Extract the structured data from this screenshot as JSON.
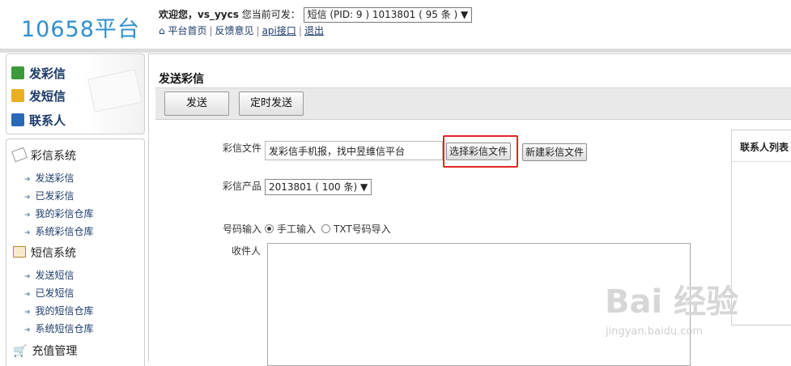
{
  "header": {
    "logo": "10658平台",
    "welcome_prefix": "欢迎您，",
    "username": "vs_yycs",
    "can_send_label": "您当前可发：",
    "account_select": "短信 (PID: 9 ) 1013801 ( 95 条 ) ▼",
    "links": [
      "平台首页",
      "反馈意见",
      "api接口",
      "退出"
    ]
  },
  "sidebar": {
    "quick": [
      "发彩信",
      "发短信",
      "联系人"
    ],
    "sections": [
      {
        "title": "彩信系统",
        "items": [
          "发送彩信",
          "已发彩信",
          "我的彩信仓库",
          "系统彩信仓库"
        ]
      },
      {
        "title": "短信系统",
        "items": [
          "发送短信",
          "已发短信",
          "我的短信仓库",
          "系统短信仓库"
        ]
      },
      {
        "title": "充值管理",
        "items": []
      }
    ]
  },
  "main": {
    "title": "发送彩信",
    "toolbar": {
      "send": "发送",
      "scheduled_send": "定时发送"
    },
    "form": {
      "file_label": "彩信文件",
      "file_value": "发彩信手机报，找中昱维信平台",
      "choose_file": "选择彩信文件",
      "new_file": "新建彩信文件",
      "product_label": "彩信产品",
      "product_value": "2013801 ( 100 条) ▼",
      "number_input_label": "号码输入",
      "manual_input": "手工输入",
      "txt_import": "TXT号码导入",
      "recipients_label": "收件人"
    },
    "contacts_title": "联系人列表"
  },
  "watermark": {
    "brand": "Bai  经验",
    "url": "jingyan.baidu.com"
  }
}
